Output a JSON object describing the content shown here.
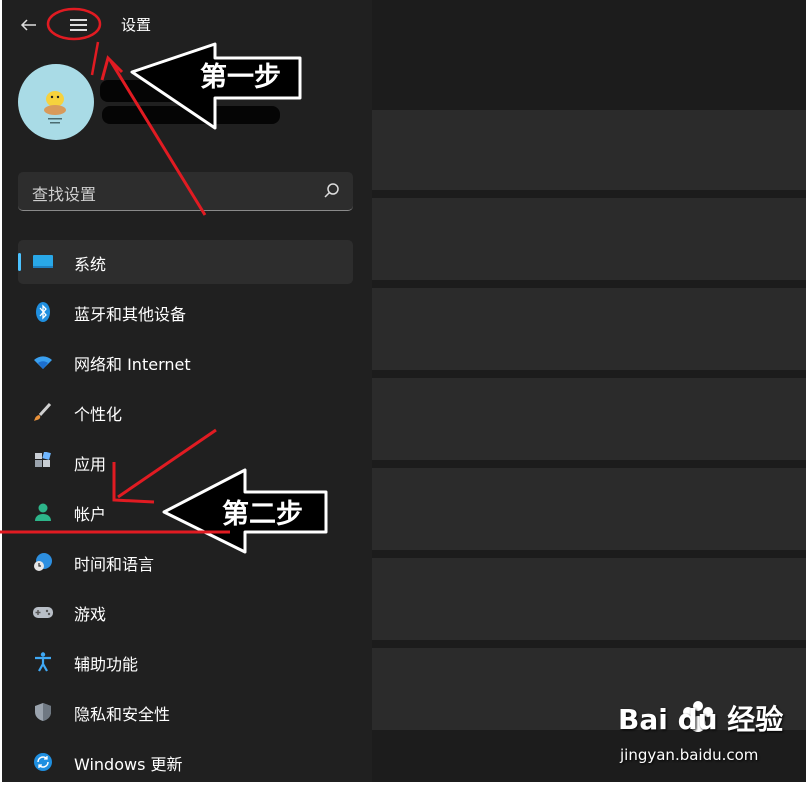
{
  "window": {
    "title": "设置",
    "back_icon": "arrow-left-icon",
    "menu_icon": "hamburger-icon"
  },
  "search": {
    "placeholder": "查找设置",
    "icon": "search-icon"
  },
  "nav": {
    "items": [
      {
        "label": "系统",
        "icon": "monitor-icon",
        "selected": true
      },
      {
        "label": "蓝牙和其他设备",
        "icon": "bluetooth-icon"
      },
      {
        "label": "网络和 Internet",
        "icon": "wifi-icon"
      },
      {
        "label": "个性化",
        "icon": "brush-icon"
      },
      {
        "label": "应用",
        "icon": "apps-icon"
      },
      {
        "label": "帐户",
        "icon": "person-icon"
      },
      {
        "label": "时间和语言",
        "icon": "globe-clock-icon"
      },
      {
        "label": "游戏",
        "icon": "gamepad-icon"
      },
      {
        "label": "辅助功能",
        "icon": "accessibility-icon"
      },
      {
        "label": "隐私和安全性",
        "icon": "shield-icon"
      },
      {
        "label": "Windows 更新",
        "icon": "update-icon"
      }
    ]
  },
  "annotations": {
    "step1": "第一步",
    "step2": "第二步"
  },
  "watermark": {
    "logo": "Bai du 经验",
    "url": "jingyan.baidu.com"
  },
  "colors": {
    "background": "#202020",
    "accent": "#4cc2ff",
    "annotation_red": "#e11b22"
  }
}
